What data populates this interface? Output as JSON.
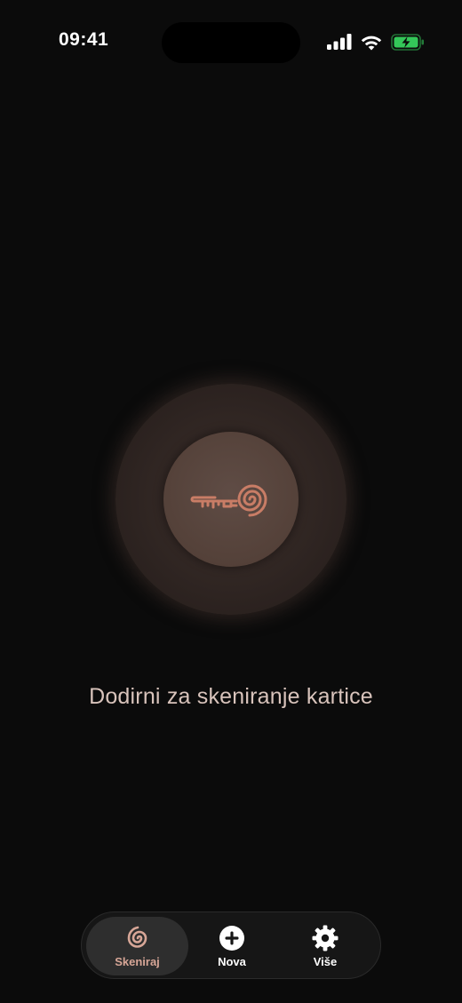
{
  "status_bar": {
    "time": "09:41",
    "icons": [
      "cellular-signal-icon",
      "wifi-icon",
      "battery-charging-icon"
    ]
  },
  "main": {
    "scan_button_icon": "key-spiral-icon",
    "hint": "Dodirni za skeniranje kartice"
  },
  "tab_bar": {
    "active": "Skeniraj",
    "tabs": [
      {
        "label": "Skeniraj",
        "icon": "spiral-icon"
      },
      {
        "label": "Nova",
        "icon": "plus-circle-icon"
      },
      {
        "label": "Više",
        "icon": "gear-icon"
      }
    ]
  },
  "colors": {
    "background": "#0b0b0b",
    "accent": "#d7a697",
    "icon_copper": "#c97d66",
    "battery_green": "#34c759"
  }
}
